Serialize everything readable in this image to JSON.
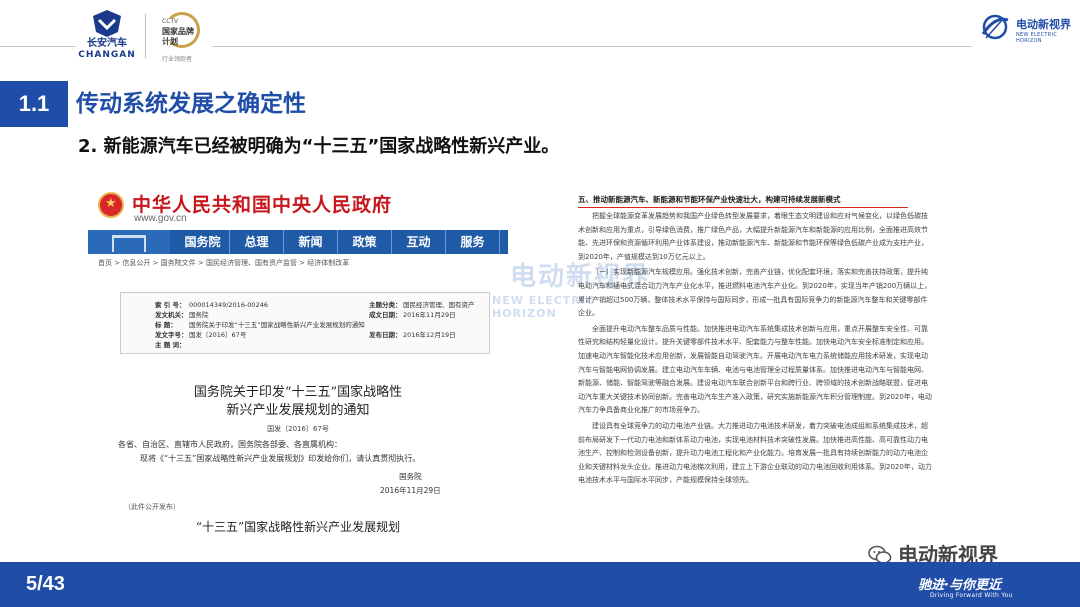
{
  "header": {
    "changan_logo_cn": "长安汽车",
    "changan_logo_en": "CHANGAN",
    "brand_badge_line1": "CCTV",
    "brand_badge_line2": "国家品牌",
    "brand_badge_line3": "计划",
    "brand_badge_line4": "行业领跑者",
    "evv_logo_cn": "电动新视界",
    "evv_logo_en": "NEW ELECTRIC HORIZON"
  },
  "title": {
    "section_number": "1.1",
    "section_title": "传动系统发展之确定性",
    "subtitle": "2. 新能源汽车已经被明确为“十三五”国家战略性新兴产业。"
  },
  "gov_page": {
    "site_name": "中华人民共和国中央人民政府",
    "site_url": "www.gov.cn",
    "nav": [
      "国务院",
      "总理",
      "新闻",
      "政策",
      "互动",
      "服务"
    ],
    "breadcrumb": "首页 > 信息公开 > 国务院文件 > 国民经济管理、国有资产监管 > 经济体制改革",
    "meta": {
      "index_no_label": "索 引 号：",
      "index_no": "000014349/2016-00246",
      "issuer_label": "发文机关：",
      "issuer": "国务院",
      "title_label": "标    题：",
      "title": "国务院关于印发“十三五”国家战略性新兴产业发展规划的通知",
      "doc_no_label": "发文字号：",
      "doc_no": "国发〔2016〕67号",
      "topic_label": "主 题 词：",
      "category_label": "主题分类：",
      "category": "国民经济管理、国有资产",
      "date_label": "成文日期：",
      "date": "2016年11月29日",
      "pub_date_label": "发布日期：",
      "pub_date": "2016年12月19日"
    },
    "notice_title_line1": "国务院关于印发“十三五”国家战略性",
    "notice_title_line2": "新兴产业发展规划的通知",
    "notice_no": "国发〔2016〕67号",
    "notice_recipients": "各省、自治区、直辖市人民政府，国务院各部委、各直属机构：",
    "notice_body": "现将《“十三五”国家战略性新兴产业发展规划》印发给你们，请认真贯彻执行。",
    "notice_signer": "国务院",
    "notice_date": "2016年11月29日",
    "notice_pub_note": "（此件公开发布）",
    "plan_title": "“十三五”国家战略性新兴产业发展规划"
  },
  "policy_text": {
    "heading": "五、推动新能源汽车、新能源和节能环保产业快速壮大，构建可持续发展新模式",
    "paragraphs": [
      "把握全球能源变革发展趋势和我国产业绿色转型发展要求，着眼生态文明建设和应对气候变化，以绿色低碳技术创新和应用为重点，引导绿色消费，推广绿色产品，大幅提升新能源汽车和新能源的应用比例，全面推进高效节能、先进环保和资源循环利用产业体系建设，推动新能源汽车、新能源和节能环保等绿色低碳产业成为支柱产业，到2020年，产值规模达到10万亿元以上。",
      "（一）实现新能源汽车规模应用。强化技术创新，完善产业链，优化配套环境，落实和完善扶持政策，提升纯电动汽车和插电式混合动力汽车产业化水平，推进燃料电池汽车产业化。到2020年，实现当年产销200万辆以上，累计产销超过500万辆，整体技术水平保持与国际同步，形成一批具有国际竞争力的新能源汽车整车和关键零部件企业。",
      "全面提升电动汽车整车品质与性能。加快推进电动汽车系统集成技术创新与应用，重点开展整车安全性、可靠性研究和结构轻量化设计。提升关键零部件技术水平、配套能力与整车性能。加快电动汽车安全标准制定和应用。加速电动汽车智能化技术应用创新，发展智能自动驾驶汽车。开展电动汽车电力系统储能应用技术研发，实现电动汽车与智能电网协调发展。建立电动汽车车辆、电池与电池管理全过程质量体系。加快推进电动汽车与智能电网、新能源、储能、智能驾驶等融合发展。建设电动汽车联合创新平台和跨行业、跨领域的技术创新战略联盟，促进电动汽车重大关键技术协同创新。完善电动汽车生产准入政策，研究实施新能源汽车积分管理制度。到2020年，电动汽车力争具备商业化推广的市场竞争力。",
      "建设具有全球竞争力的动力电池产业链。大力推进动力电池技术研发，着力突破电池成组和系统集成技术，超前布局研发下一代动力电池和新体系动力电池，实现电池材料技术突破性发展。加快推进高性能、高可靠性动力电池生产、控制和检测设备创新，提升动力电池工程化和产业化能力。培育发展一批具有持续创新能力的动力电池企业和关键材料龙头企业。推进动力电池梯次利用，建立上下游企业联动的动力电池回收利用体系。到2020年，动力电池技术水平与国际水平同步，产能规模保持全球领先。"
    ]
  },
  "watermark": {
    "cn": "电动新视界",
    "en": "NEW ELECTRIC HORIZON"
  },
  "footer": {
    "page": "5/43",
    "wechat_name": "电动新视界",
    "slogan": "驰进·与你更近",
    "slogan_en": "Driving Forward With You"
  },
  "colors": {
    "primary_blue": "#1f4da8",
    "gov_red": "#c8161d",
    "underline_red": "#d9261c"
  }
}
